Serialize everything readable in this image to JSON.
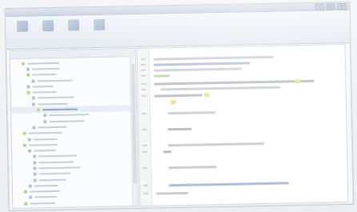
{
  "window": {
    "title": "",
    "controls": [
      "–",
      "□",
      "×"
    ]
  },
  "toolbar": {
    "tools": [
      {
        "icon": "new-file-icon",
        "label": ""
      },
      {
        "icon": "open-folder-icon",
        "label": ""
      },
      {
        "icon": "save-icon",
        "label": ""
      },
      {
        "icon": "settings-icon",
        "label": ""
      }
    ]
  },
  "navigator": {
    "header": "",
    "rows": 25
  },
  "editor": {
    "lines": 14
  },
  "colors": {
    "ribbon": "#e5eaf1",
    "accent": "#6f8fb3",
    "highlight": "#e8e58a",
    "tree_icon_green": "#b9d37a"
  }
}
